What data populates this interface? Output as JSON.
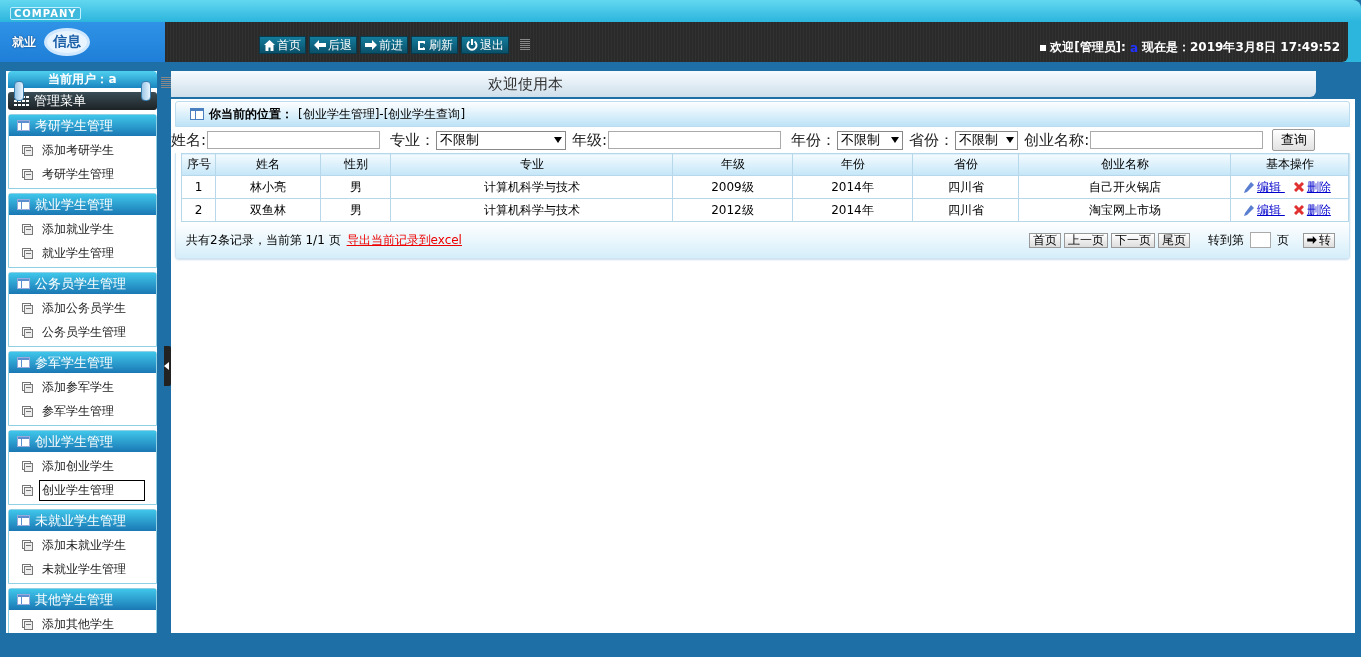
{
  "header": {
    "company": "COMPANY",
    "logo": [
      "就业",
      "信息"
    ],
    "nav_buttons": [
      {
        "kind": "home",
        "label": "首页"
      },
      {
        "kind": "back",
        "label": "后退"
      },
      {
        "kind": "forward",
        "label": "前进"
      },
      {
        "kind": "refresh",
        "label": "刷新"
      },
      {
        "kind": "exit",
        "label": "退出"
      }
    ],
    "welcome": "欢迎[管理员]:",
    "user": "a",
    "time": "现在是：2019年3月8日 17:49:52"
  },
  "sidebar": {
    "user": "当前用户：a",
    "menu_title": "管理菜单",
    "groups": [
      {
        "title": "考研学生管理",
        "items": [
          {
            "label": "添加考研学生",
            "selected": false
          },
          {
            "label": "考研学生管理",
            "selected": false
          }
        ]
      },
      {
        "title": "就业学生管理",
        "items": [
          {
            "label": "添加就业学生",
            "selected": false
          },
          {
            "label": "就业学生管理",
            "selected": false
          }
        ]
      },
      {
        "title": "公务员学生管理",
        "items": [
          {
            "label": "添加公务员学生",
            "selected": false
          },
          {
            "label": "公务员学生管理",
            "selected": false
          }
        ]
      },
      {
        "title": "参军学生管理",
        "items": [
          {
            "label": "添加参军学生",
            "selected": false
          },
          {
            "label": "参军学生管理",
            "selected": false
          }
        ]
      },
      {
        "title": "创业学生管理",
        "items": [
          {
            "label": "添加创业学生",
            "selected": false
          },
          {
            "label": "创业学生管理",
            "selected": true
          }
        ]
      },
      {
        "title": "未就业学生管理",
        "items": [
          {
            "label": "添加未就业学生",
            "selected": false
          },
          {
            "label": "未就业学生管理",
            "selected": false
          }
        ]
      },
      {
        "title": "其他学生管理",
        "items": [
          {
            "label": "添加其他学生",
            "selected": false
          }
        ]
      }
    ]
  },
  "marquee": "欢迎使用本",
  "breadcrumb": {
    "label": "你当前的位置：",
    "path": "[创业学生管理]-[创业学生查询]"
  },
  "filters": [
    {
      "kind": "text",
      "label": "姓名:"
    },
    {
      "kind": "select",
      "label": "专业：",
      "value": "不限制"
    },
    {
      "kind": "text",
      "label": "年级:"
    },
    {
      "kind": "select",
      "label": "年份：",
      "value": "不限制"
    },
    {
      "kind": "select",
      "label": "省份：",
      "value": "不限制"
    },
    {
      "kind": "text",
      "label": "创业名称:"
    }
  ],
  "search_button": "查询",
  "table": {
    "columns": [
      "序号",
      "姓名",
      "性别",
      "专业",
      "年级",
      "年份",
      "省份",
      "创业名称",
      "基本操作"
    ],
    "rows": [
      {
        "cells": [
          "1",
          "林小亮",
          "男",
          "计算机科学与技术",
          "2009级",
          "2014年",
          "四川省",
          "自己开火锅店"
        ],
        "actions": [
          "编辑",
          "删除"
        ]
      },
      {
        "cells": [
          "2",
          "双鱼林",
          "男",
          "计算机科学与技术",
          "2012级",
          "2014年",
          "四川省",
          "淘宝网上市场"
        ],
        "actions": [
          "编辑",
          "删除"
        ]
      }
    ]
  },
  "footer": {
    "summary": "共有2条记录，当前第 1/1 页",
    "export_link": "导出当前记录到excel",
    "pager": [
      "首页",
      "上一页",
      "下一页",
      "尾页"
    ],
    "goto_label": "转到第",
    "goto_suffix": "页",
    "go_button": "转"
  }
}
